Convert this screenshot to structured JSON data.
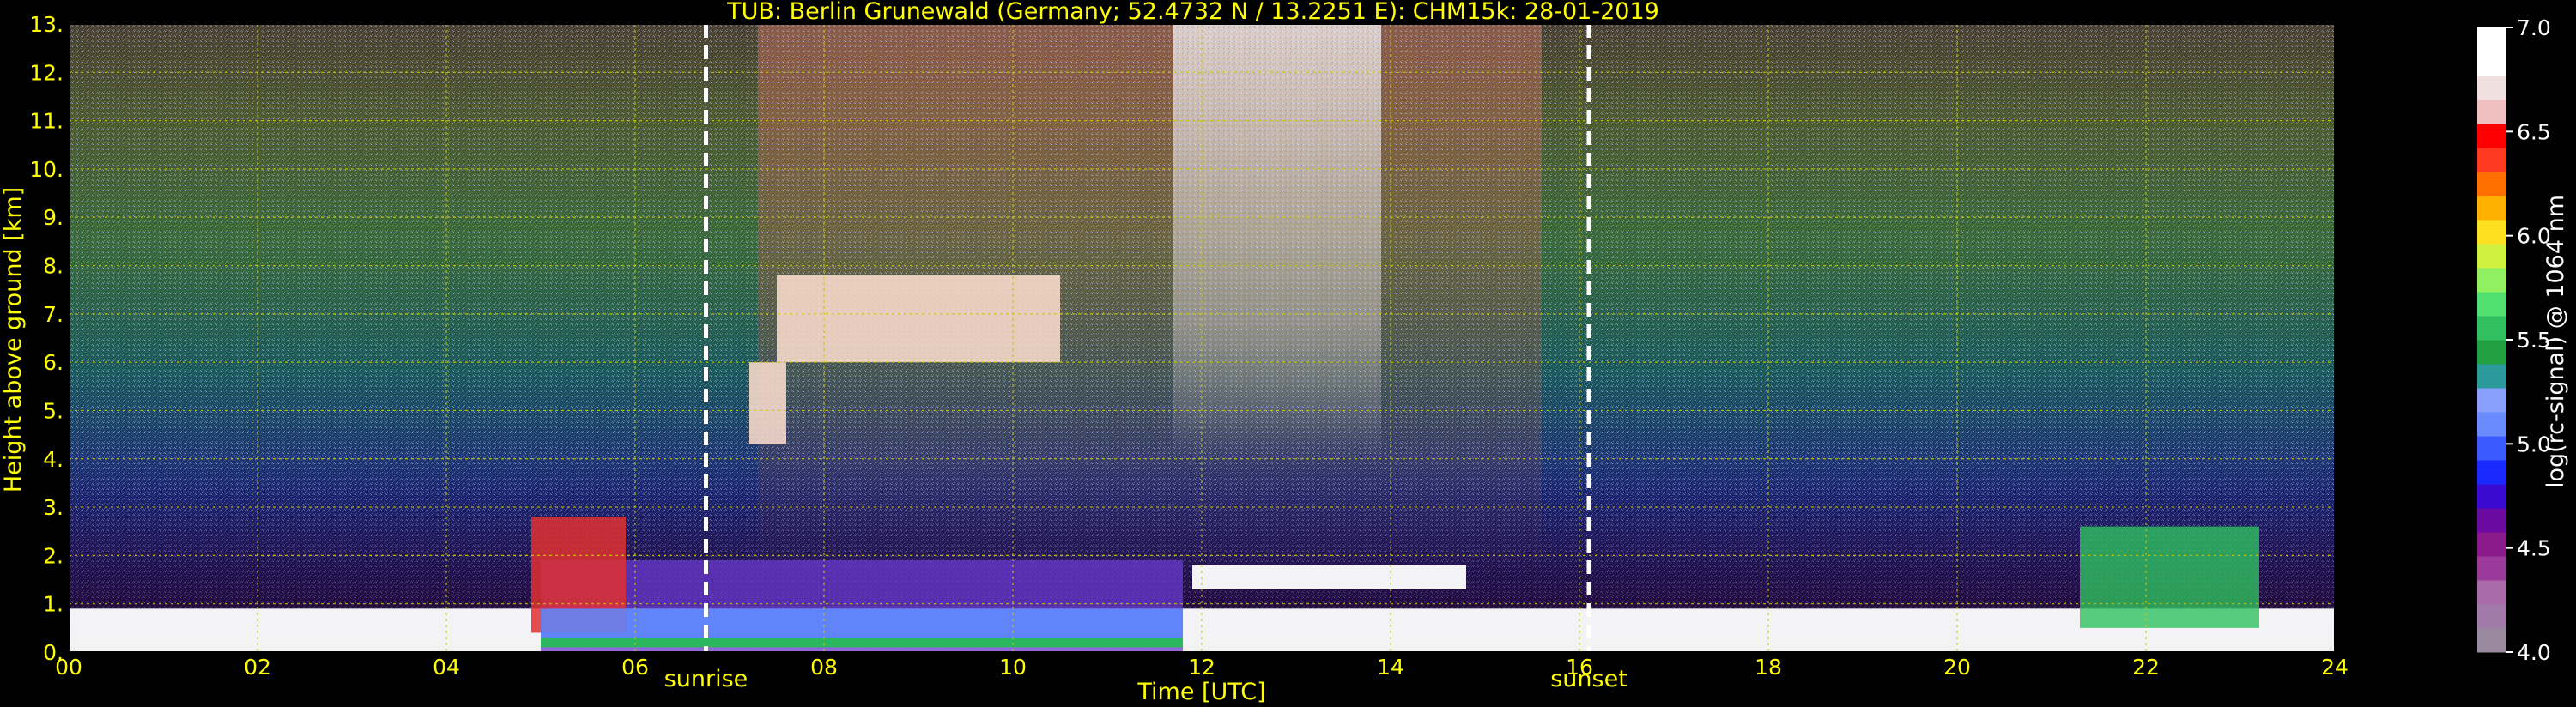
{
  "chart_data": {
    "type": "heatmap",
    "title": "TUB: Berlin Grunewald (Germany; 52.4732 N / 13.2251 E):    CHM15k: 28-01-2019",
    "xlabel": "Time [UTC]",
    "ylabel": "Height above ground [km]",
    "xlim": [
      0,
      24
    ],
    "ylim": [
      0,
      13
    ],
    "x_ticks": [
      "00",
      "02",
      "04",
      "06",
      "08",
      "10",
      "12",
      "14",
      "16",
      "18",
      "20",
      "22",
      "24"
    ],
    "y_ticks": [
      "0.",
      "1.",
      "2.",
      "3.",
      "4.",
      "5.",
      "6.",
      "7.",
      "8.",
      "9.",
      "10.",
      "11.",
      "12.",
      "13."
    ],
    "grid": true,
    "markers": [
      {
        "label": "sunrise",
        "x": 6.75
      },
      {
        "label": "sunset",
        "x": 16.1
      }
    ],
    "colorbar": {
      "label": "log(rc-signal) @ 1064 nm",
      "range": [
        4.0,
        7.0
      ],
      "ticks": [
        "4.0",
        "4.5",
        "5.0",
        "5.5",
        "6.0",
        "6.5",
        "7.0"
      ]
    },
    "signal_features": [
      {
        "feature": "surface boundary layer",
        "x_start": 0,
        "x_end": 24,
        "height_top": 0.9
      },
      {
        "feature": "residual aerosol layer",
        "x_start": 5,
        "x_end": 11.8,
        "height_top": 1.9
      },
      {
        "feature": "cloud layer",
        "x_start": 11.9,
        "x_end": 14.8,
        "height_base": 1.3,
        "height_top": 1.8
      },
      {
        "feature": "low cloud",
        "x_start": 4.9,
        "x_end": 5.9,
        "height_base": 0.4,
        "height_top": 2.8
      },
      {
        "feature": "mid-level cloud",
        "x_start": 7.5,
        "x_end": 10.5,
        "height_base": 6.0,
        "height_top": 7.8
      },
      {
        "feature": "mid-level cloud",
        "x_start": 7.2,
        "x_end": 7.6,
        "height_base": 4.3,
        "height_top": 6.0
      },
      {
        "feature": "boundary layer clouds",
        "x_start": 21.3,
        "x_end": 23.2,
        "height_base": 0.5,
        "height_top": 2.6
      }
    ]
  },
  "colors": {
    "background": "#000000",
    "text": "#ffff00",
    "grid": "#c8c800",
    "marker": "#ffffff",
    "colorbar_text": "#ffffff"
  }
}
